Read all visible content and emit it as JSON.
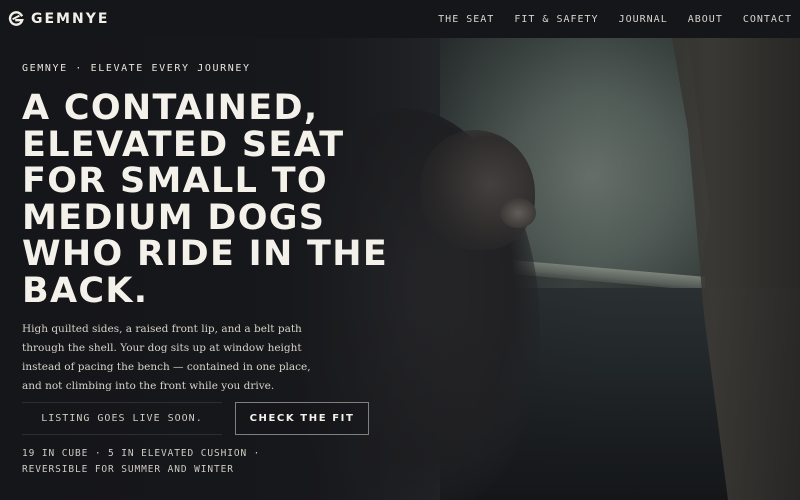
{
  "brand": {
    "name": "GEMNYE",
    "logo_icon": "g-mark-icon"
  },
  "nav": {
    "items": [
      {
        "label": "THE SEAT"
      },
      {
        "label": "FIT & SAFETY"
      },
      {
        "label": "JOURNAL"
      },
      {
        "label": "ABOUT"
      },
      {
        "label": "CONTACT"
      }
    ]
  },
  "hero": {
    "eyebrow": "GEMNYE · ELEVATE EVERY JOURNEY",
    "headline": "A CONTAINED, ELEVATED SEAT FOR SMALL TO MEDIUM DOGS WHO RIDE IN THE BACK.",
    "body": "High quilted sides, a raised front lip, and a belt path through the shell. Your dog sits up at window height instead of pacing the bench — contained in one place, and not climbing into the front while you drive.",
    "notice": "LISTING GOES LIVE SOON.",
    "cta_label": "CHECK THE FIT",
    "specs_line1": "19 IN CUBE · 5 IN ELEVATED CUSHION ·",
    "specs_line2": "REVERSIBLE FOR SUMMER AND WINTER",
    "image_description_icon": "dog-in-car-photo"
  },
  "colors": {
    "background": "#15161a",
    "text": "#f2efe8",
    "muted_text": "#cfcbc2"
  }
}
